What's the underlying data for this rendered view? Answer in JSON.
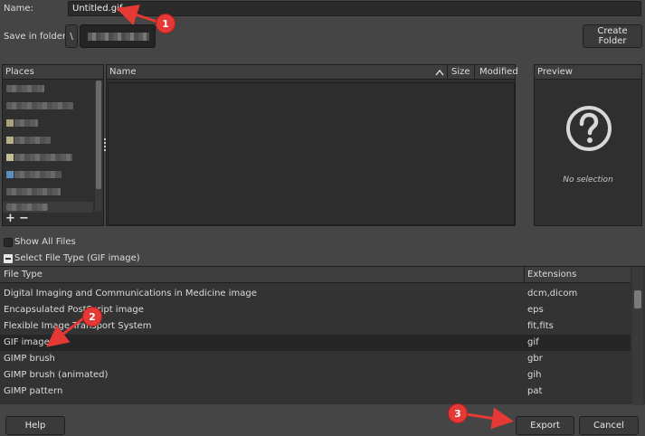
{
  "name_row": {
    "label": "Name:",
    "value": "Untitled.gif"
  },
  "folder_row": {
    "label": "Save in folder:",
    "root": "\\",
    "create_folder": "Create Folder"
  },
  "places": {
    "header": "Places",
    "add": "+",
    "remove": "−"
  },
  "files": {
    "col_name": "Name",
    "col_size": "Size",
    "col_modified": "Modified"
  },
  "preview": {
    "header": "Preview",
    "empty": "No selection"
  },
  "show_all_files": "Show All Files",
  "select_file_type": "Select File Type (GIF image)",
  "file_types": {
    "col_type": "File Type",
    "col_ext": "Extensions",
    "rows": [
      {
        "type": "Digital Imaging and Communications in Medicine image",
        "ext": "dcm,dicom"
      },
      {
        "type": "Encapsulated PostScript image",
        "ext": "eps"
      },
      {
        "type": "Flexible Image Transport System",
        "ext": "fit,fits"
      },
      {
        "type": "GIF image",
        "ext": "gif"
      },
      {
        "type": "GIMP brush",
        "ext": "gbr"
      },
      {
        "type": "GIMP brush (animated)",
        "ext": "gih"
      },
      {
        "type": "GIMP pattern",
        "ext": "pat"
      }
    ]
  },
  "buttons": {
    "help": "Help",
    "export": "Export",
    "cancel": "Cancel"
  },
  "annotations": [
    "1",
    "2",
    "3"
  ],
  "colors": {
    "annotation": "#e53935",
    "background": "#454545",
    "panel": "#2f2f2f",
    "selected_row": "#262626"
  }
}
